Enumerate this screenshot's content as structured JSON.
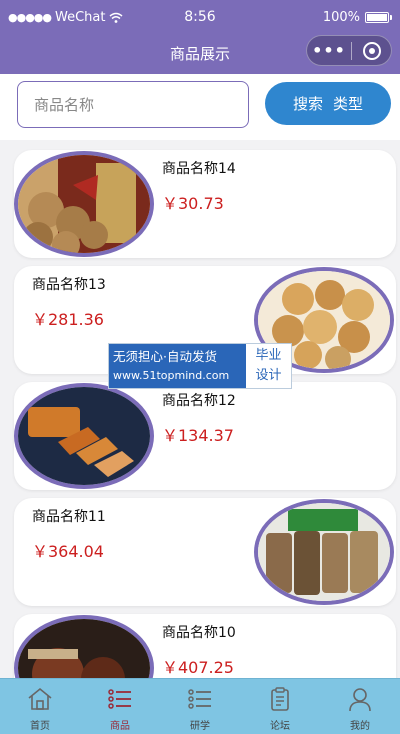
{
  "status_bar": {
    "carrier": "WeChat",
    "time": "8:56",
    "battery": "100%"
  },
  "nav": {
    "title": "商品展示",
    "more_glyph": "•••"
  },
  "search": {
    "placeholder": "商品名称",
    "search_label": "搜索",
    "type_label": "类型"
  },
  "products": [
    {
      "name": "商品名称14",
      "price": "￥30.73",
      "image": "walnuts-photo"
    },
    {
      "name": "商品名称13",
      "price": "￥281.36",
      "image": "dried-figs-photo"
    },
    {
      "name": "商品名称12",
      "price": "￥134.37",
      "image": "sliced-cake-photo"
    },
    {
      "name": "商品名称11",
      "price": "￥364.04",
      "image": "packaged-snacks-photo"
    },
    {
      "name": "商品名称10",
      "price": "￥407.25",
      "image": "dried-fruit-photo"
    }
  ],
  "watermark": {
    "line1": "无须担心·自动发货",
    "line2": "www.51topmind.com",
    "right_line1": "毕业",
    "right_line2": "设计"
  },
  "tabs": [
    {
      "label": "首页",
      "icon": "home-icon"
    },
    {
      "label": "商品",
      "icon": "list-icon",
      "active": true
    },
    {
      "label": "研学",
      "icon": "list-icon"
    },
    {
      "label": "论坛",
      "icon": "clipboard-icon"
    },
    {
      "label": "我的",
      "icon": "user-icon"
    }
  ],
  "colors": {
    "theme": "#7b6cb8",
    "price": "#cc1f1f",
    "search_button": "#2f86cf",
    "tab_bar": "#7fc5e3"
  }
}
